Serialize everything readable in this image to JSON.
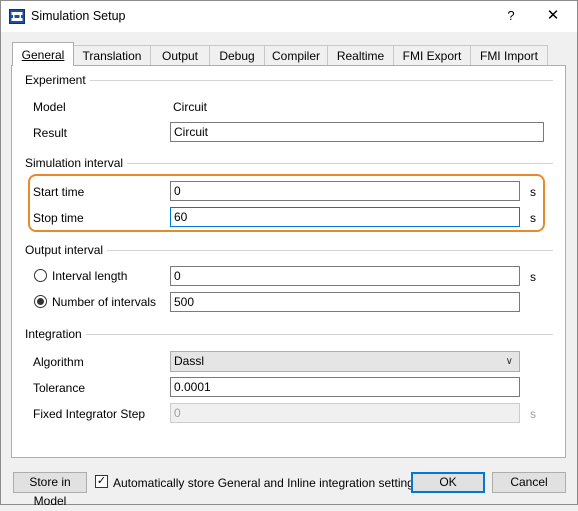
{
  "window": {
    "title": "Simulation Setup",
    "help_glyph": "?",
    "close_glyph": "✕"
  },
  "tabs": [
    {
      "label": "General",
      "active": true
    },
    {
      "label": "Translation"
    },
    {
      "label": "Output"
    },
    {
      "label": "Debug"
    },
    {
      "label": "Compiler"
    },
    {
      "label": "Realtime"
    },
    {
      "label": "FMI Export"
    },
    {
      "label": "FMI Import"
    }
  ],
  "experiment": {
    "title": "Experiment",
    "model_label": "Model",
    "model_value": "Circuit",
    "result_label": "Result",
    "result_value": "Circuit"
  },
  "simulation_interval": {
    "title": "Simulation interval",
    "start_label": "Start time",
    "start_value": "0",
    "stop_label": "Stop time",
    "stop_value": "60",
    "unit": "s"
  },
  "output_interval": {
    "title": "Output interval",
    "interval_length_label": "Interval length",
    "interval_length_value": "0",
    "number_label": "Number of intervals",
    "number_value": "500",
    "selected": "Number of intervals",
    "unit": "s"
  },
  "integration": {
    "title": "Integration",
    "algorithm_label": "Algorithm",
    "algorithm_value": "Dassl",
    "tolerance_label": "Tolerance",
    "tolerance_value": "0.0001",
    "fixed_step_label": "Fixed Integrator Step",
    "fixed_step_value": "0",
    "unit": "s"
  },
  "footer": {
    "store_button": "Store in Model",
    "auto_store_label": "Automatically store General and Inline integration settings",
    "auto_store_checked": true,
    "ok_button": "OK",
    "cancel_button": "Cancel"
  },
  "colors": {
    "highlight": "#e68a2e",
    "focus": "#0078d7"
  }
}
